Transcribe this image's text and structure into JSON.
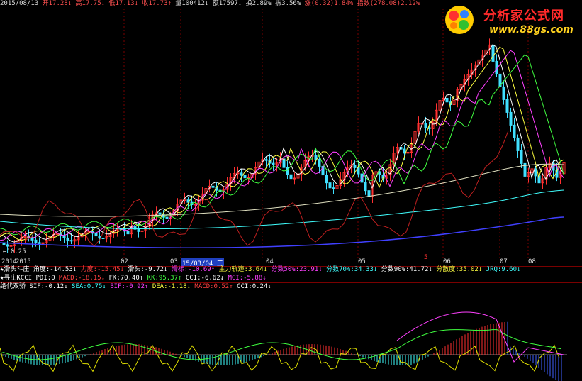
{
  "topbar": [
    {
      "text": "2015/08/13",
      "color": "#dddddd"
    },
    {
      "text": " 开17.28↓",
      "color": "#ff5050"
    },
    {
      "text": " 高17.75↓",
      "color": "#ff5050"
    },
    {
      "text": " 低17.13↓",
      "color": "#ff5050"
    },
    {
      "text": " 收17.73↑",
      "color": "#ff5050"
    },
    {
      "text": " 量100412↓",
      "color": "#dddddd"
    },
    {
      "text": " 额17597↓",
      "color": "#dddddd"
    },
    {
      "text": " 换2.89%",
      "color": "#dddddd"
    },
    {
      "text": " 振3.56%",
      "color": "#dddddd"
    },
    {
      "text": " 涨(0.32)1.84%",
      "color": "#ff5050"
    },
    {
      "text": " 指数(278.08)2.12%",
      "color": "#ff5050"
    }
  ],
  "logo": {
    "title": "分析家公式网",
    "url": "www.88gs.com"
  },
  "price_low_label": "←10.25",
  "time_axis": {
    "labels": [
      "2014",
      "2015",
      "02",
      "03",
      "15/03/04_三",
      "04",
      "05",
      "06",
      "07",
      "08"
    ],
    "marker": "5"
  },
  "indicator_rows": [
    [
      {
        "text": "★滑头斗庄 ",
        "color": "#ffffff"
      },
      {
        "text": "角度:-14.53↓",
        "color": "#ffffff"
      },
      {
        "text": " 力度:-15.45↓",
        "color": "#ff4040"
      },
      {
        "text": " 滑头:-9.72↓",
        "color": "#ffffff"
      },
      {
        "text": " 滑标:-10.69↑",
        "color": "#ff40ff"
      },
      {
        "text": " 主力轨迹:3.64↓",
        "color": "#ffff40"
      },
      {
        "text": " 分数50%:23.91↓",
        "color": "#ff40ff"
      },
      {
        "text": " 分数70%:34.33↓",
        "color": "#40ffff"
      },
      {
        "text": " 分数90%:41.72↓",
        "color": "#ffffff"
      },
      {
        "text": " 分散度:35.02↓",
        "color": "#ffff40"
      },
      {
        "text": " JRQ:9.60↓",
        "color": "#40ffff"
      }
    ],
    [
      {
        "text": "★寻庄KCCI ",
        "color": "#ffffff"
      },
      {
        "text": "PDI:0",
        "color": "#ffffff"
      },
      {
        "text": " MACD:-18.15↓",
        "color": "#ff4040"
      },
      {
        "text": " FK:70.40↑",
        "color": "#ffffff"
      },
      {
        "text": " KK:95.37↑",
        "color": "#40ff40"
      },
      {
        "text": " CCI:-6.62↓",
        "color": "#ffffff"
      },
      {
        "text": " MCI:-5.88↓",
        "color": "#ff40ff"
      }
    ],
    [
      {
        "text": "绝代双骄 ",
        "color": "#ffffff"
      },
      {
        "text": "SIF:-0.12↓",
        "color": "#ffffff"
      },
      {
        "text": " SEA:0.75↓",
        "color": "#40ffff"
      },
      {
        "text": " BIF:-0.92↑",
        "color": "#ff40ff"
      },
      {
        "text": " DEA:-1.18↓",
        "color": "#ffff40"
      },
      {
        "text": " MACD:0.52↑",
        "color": "#ff4040"
      },
      {
        "text": " CCI:0.24↓",
        "color": "#ffffff"
      }
    ]
  ],
  "colors": {
    "up": "#ff3030",
    "down": "#40e0ff",
    "grid": "#7a0000"
  }
}
